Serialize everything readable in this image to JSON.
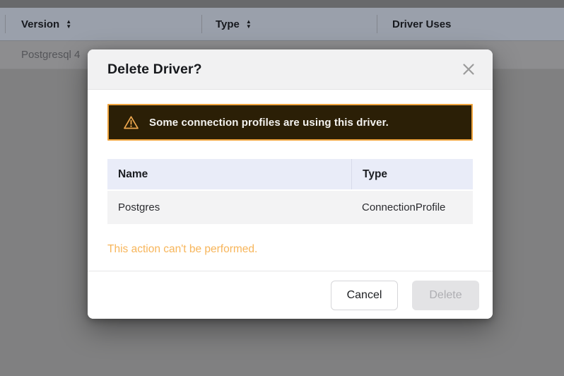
{
  "background_table": {
    "columns": [
      {
        "label": "Version",
        "sortable": true
      },
      {
        "label": "Type",
        "sortable": true
      },
      {
        "label": "Driver Uses",
        "sortable": false
      }
    ],
    "row_text": "Postgresql 4"
  },
  "icons": {
    "sort_up": "▲",
    "sort_down": "▼"
  },
  "modal": {
    "title": "Delete Driver?",
    "warning_banner": {
      "text": "Some connection profiles are using this driver."
    },
    "table": {
      "headers": {
        "name": "Name",
        "type": "Type"
      },
      "rows": [
        {
          "name": "Postgres",
          "type": "ConnectionProfile"
        }
      ]
    },
    "error_text": "This action can't be performed.",
    "buttons": {
      "cancel": "Cancel",
      "delete": "Delete"
    },
    "delete_disabled": true
  },
  "colors": {
    "warning_accent": "#efa43e",
    "warning_banner_bg": "#2b1f06",
    "error_text": "#f7b55a",
    "table_header_bg": "#e9ecf8",
    "overlay_gray": "#808081"
  }
}
